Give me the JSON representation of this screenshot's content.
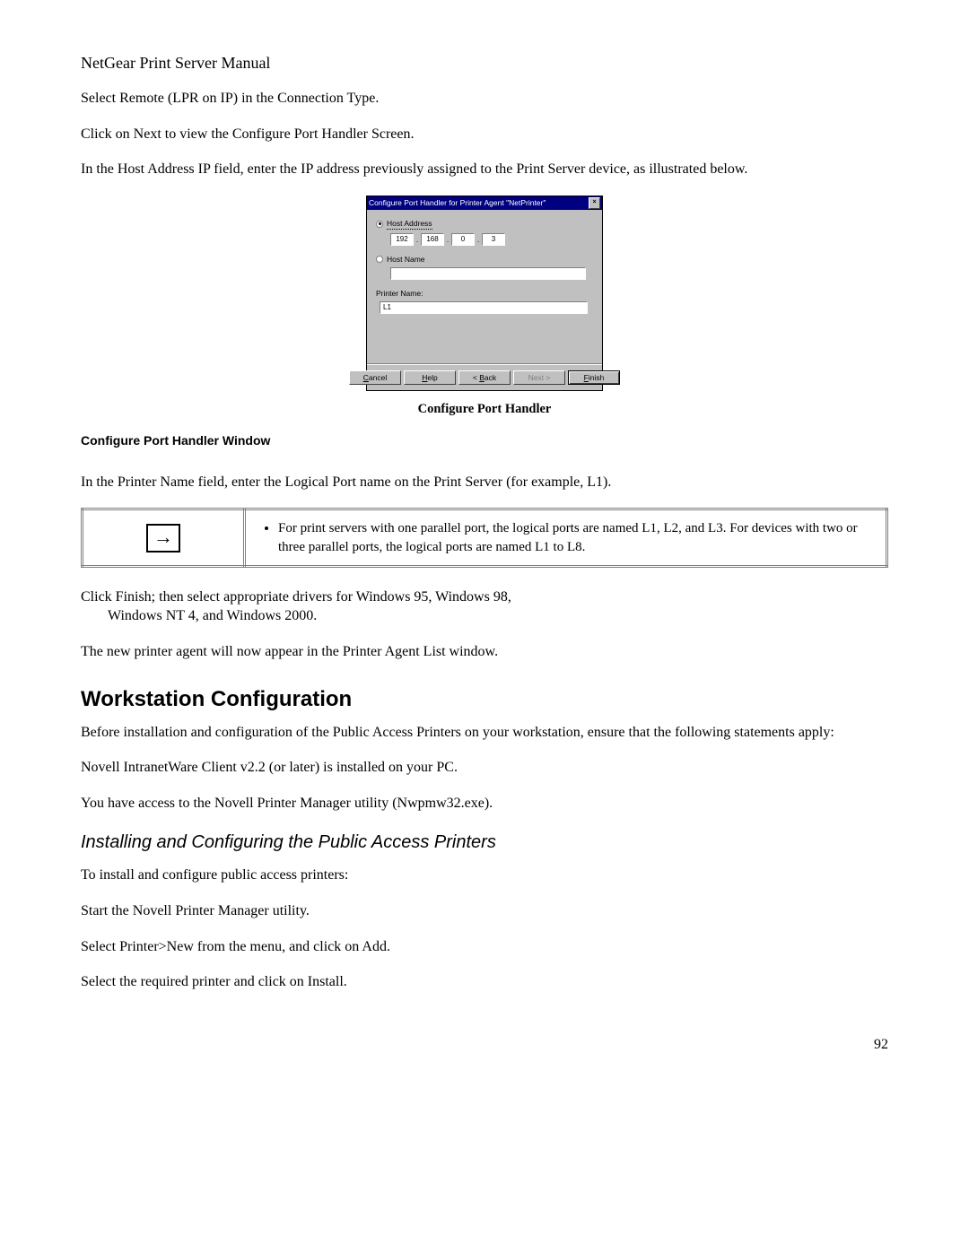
{
  "header": "NetGear Print Server Manual",
  "p1": "Select Remote (LPR on IP) in the Connection Type.",
  "p2": "Click on Next to view the Configure Port Handler Screen.",
  "p3": "In the Host Address IP field, enter the IP address previously assigned to the Print Server device, as illustrated below.",
  "dialog": {
    "title": "Configure Port Handler for Printer Agent \"NetPrinter\"",
    "close": "×",
    "host_address_label": "Host Address",
    "ip": [
      "192",
      "168",
      "0",
      "3"
    ],
    "host_name_label": "Host Name",
    "host_name_value": "",
    "printer_name_label": "Printer Name:",
    "printer_name_value": "L1",
    "buttons": {
      "cancel": "Cancel",
      "help": "Help",
      "back": "< Back",
      "next": "Next >",
      "finish": "Finish"
    }
  },
  "caption": "Configure Port Handler",
  "subheading": "Configure Port Handler Window",
  "p4": "In the Printer Name field, enter the Logical Port name on the Print Server (for example, L1).",
  "arrow": "→",
  "note_text": "For print servers with one parallel port, the logical ports are named L1, L2, and L3. For devices with two or three parallel ports, the logical ports are named L1 to L8.",
  "p5a": "Click Finish; then select appropriate drivers for Windows 95, Windows 98,",
  "p5b": "Windows NT 4, and Windows 2000.",
  "p6": "The new printer agent will now appear in the Printer Agent List window.",
  "h2": "Workstation Configuration",
  "p7": "Before installation and configuration of the Public Access Printers on your workstation, ensure that the following statements apply:",
  "p8": "Novell IntranetWare Client v2.2 (or later) is installed on your PC.",
  "p9": "You have access to the Novell Printer Manager utility (Nwpmw32.exe).",
  "h3": "Installing and Configuring the Public Access Printers",
  "p10": "To install and configure public access printers:",
  "p11": "Start the Novell Printer Manager utility.",
  "p12": "Select Printer>New from the menu, and click on Add.",
  "p13": "Select the required printer and click on Install.",
  "page_number": "92"
}
